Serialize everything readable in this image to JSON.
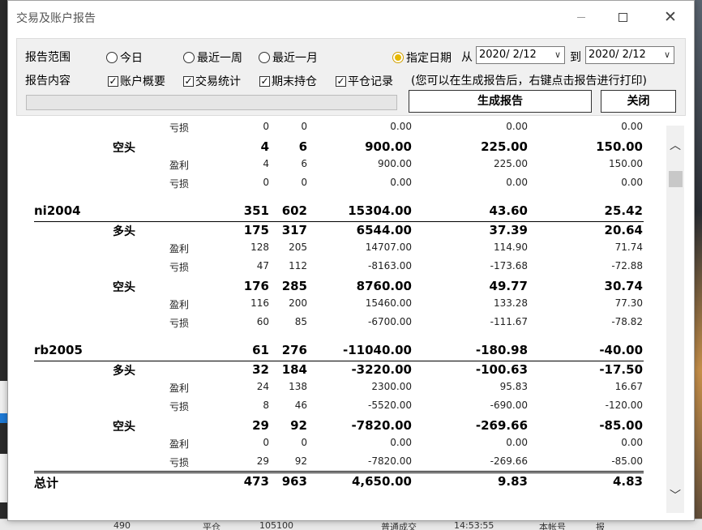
{
  "window": {
    "title": "交易及账户报告"
  },
  "scope": {
    "label": "报告范围",
    "options": [
      "今日",
      "最近一周",
      "最近一月",
      "指定日期"
    ],
    "selected": "指定日期",
    "from_label": "从",
    "from_date": "2020/ 2/12",
    "to_label": "到",
    "to_date": "2020/ 2/12"
  },
  "content": {
    "label": "报告内容",
    "checks": [
      "账户概要",
      "交易统计",
      "期末持仓",
      "平仓记录"
    ],
    "hint": "(您可以在生成报告后，右键点击报告进行打印)"
  },
  "buttons": {
    "generate": "生成报告",
    "close": "关闭"
  },
  "report": {
    "rows": [
      {
        "kind": "sub",
        "l3": "亏损",
        "v": [
          "0",
          "0",
          "0.00",
          "0.00",
          "0.00"
        ]
      },
      {
        "kind": "dir",
        "l2": "空头",
        "v": [
          "4",
          "6",
          "900.00",
          "225.00",
          "150.00"
        ]
      },
      {
        "kind": "sub",
        "l3": "盈利",
        "v": [
          "4",
          "6",
          "900.00",
          "225.00",
          "150.00"
        ]
      },
      {
        "kind": "sub",
        "l3": "亏损",
        "v": [
          "0",
          "0",
          "0.00",
          "0.00",
          "0.00"
        ]
      },
      {
        "kind": "gap"
      },
      {
        "kind": "sym",
        "l1": "ni2004",
        "v": [
          "351",
          "602",
          "15304.00",
          "43.60",
          "25.42"
        ]
      },
      {
        "kind": "dir",
        "l2": "多头",
        "v": [
          "175",
          "317",
          "6544.00",
          "37.39",
          "20.64"
        ]
      },
      {
        "kind": "sub",
        "l3": "盈利",
        "v": [
          "128",
          "205",
          "14707.00",
          "114.90",
          "71.74"
        ]
      },
      {
        "kind": "sub",
        "l3": "亏损",
        "v": [
          "47",
          "112",
          "-8163.00",
          "-173.68",
          "-72.88"
        ]
      },
      {
        "kind": "dir",
        "l2": "空头",
        "v": [
          "176",
          "285",
          "8760.00",
          "49.77",
          "30.74"
        ]
      },
      {
        "kind": "sub",
        "l3": "盈利",
        "v": [
          "116",
          "200",
          "15460.00",
          "133.28",
          "77.30"
        ]
      },
      {
        "kind": "sub",
        "l3": "亏损",
        "v": [
          "60",
          "85",
          "-6700.00",
          "-111.67",
          "-78.82"
        ]
      },
      {
        "kind": "gap"
      },
      {
        "kind": "sym",
        "l1": "rb2005",
        "v": [
          "61",
          "276",
          "-11040.00",
          "-180.98",
          "-40.00"
        ]
      },
      {
        "kind": "dir",
        "l2": "多头",
        "v": [
          "32",
          "184",
          "-3220.00",
          "-100.63",
          "-17.50"
        ]
      },
      {
        "kind": "sub",
        "l3": "盈利",
        "v": [
          "24",
          "138",
          "2300.00",
          "95.83",
          "16.67"
        ]
      },
      {
        "kind": "sub",
        "l3": "亏损",
        "v": [
          "8",
          "46",
          "-5520.00",
          "-690.00",
          "-120.00"
        ]
      },
      {
        "kind": "dir",
        "l2": "空头",
        "v": [
          "29",
          "92",
          "-7820.00",
          "-269.66",
          "-85.00"
        ]
      },
      {
        "kind": "sub",
        "l3": "盈利",
        "v": [
          "0",
          "0",
          "0.00",
          "0.00",
          "0.00"
        ]
      },
      {
        "kind": "sub",
        "l3": "亏损",
        "v": [
          "29",
          "92",
          "-7820.00",
          "-269.66",
          "-85.00"
        ]
      },
      {
        "kind": "tot",
        "l1": "总计",
        "v": [
          "473",
          "963",
          "4,650.00",
          "9.83",
          "4.83"
        ]
      }
    ]
  },
  "background": {
    "bottom_texts": [
      "490",
      "平仓",
      "105100",
      "普通成交",
      "14:53:55",
      "本帐号",
      "报"
    ]
  }
}
